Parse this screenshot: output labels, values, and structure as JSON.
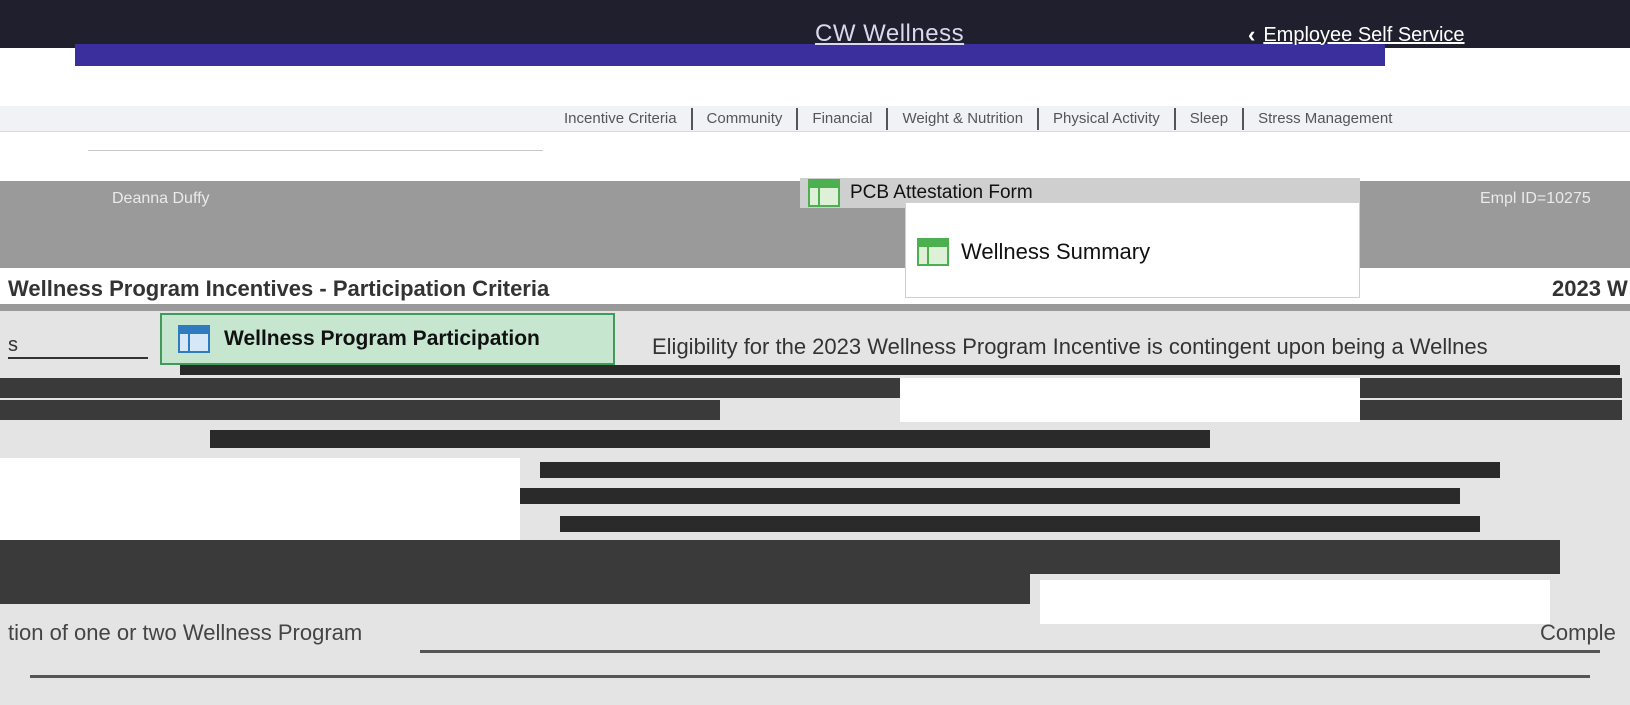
{
  "header": {
    "brand": "CW Wellness",
    "back_label": "Employee Self Service"
  },
  "nav": {
    "tabs": [
      "Incentive Criteria",
      "Community",
      "Financial",
      "Weight & Nutrition",
      "Physical Activity",
      "Sleep",
      "Stress Management"
    ]
  },
  "employee": {
    "name": "Deanna Duffy",
    "id_label": "Empl ID=10275"
  },
  "menu": {
    "items": [
      "PCB Attestation Form",
      "Wellness Summary"
    ]
  },
  "page": {
    "title": "Wellness Program Incentives - Participation Criteria",
    "year_title": "2023 W"
  },
  "left": {
    "stub": "s"
  },
  "participation": {
    "label": "Wellness Program Participation"
  },
  "content": {
    "eligibility": "Eligibility for the 2023 Wellness Program Incentive is contingent upon being a Wellnes",
    "bottom": "tion of one or two Wellness Program",
    "bottom_right": "Comple"
  }
}
